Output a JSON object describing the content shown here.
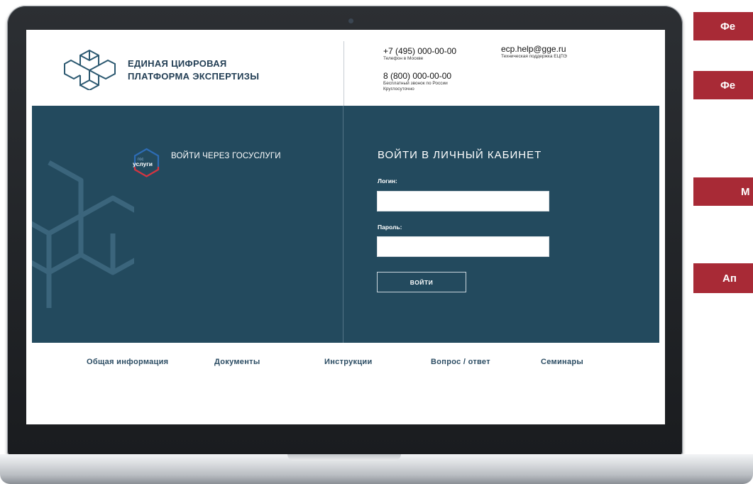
{
  "header": {
    "brand_line1": "ЕДИНАЯ ЦИФРОВАЯ",
    "brand_line2": "ПЛАТФОРМА ЭКСПЕРТИЗЫ",
    "phone_moscow": "+7 (495) 000-00-00",
    "phone_moscow_caption": "Телефон в Москве",
    "phone_free": "8 (800) 000-00-00",
    "phone_free_caption1": "Бесплатный звонок по России",
    "phone_free_caption2": "Круглосуточно",
    "email": "ecp.help@gge.ru",
    "email_caption": "Техническая поддержка ЕЦПЭ"
  },
  "gosuslugi": {
    "logo_text_top": "гос",
    "logo_text_main": "услуги",
    "label": "ВОЙТИ ЧЕРЕЗ ГОСУСЛУГИ"
  },
  "login": {
    "title": "ВОЙТИ В ЛИЧНЫЙ КАБИНЕТ",
    "login_label": "Логин:",
    "login_value": "",
    "password_label": "Пароль:",
    "password_value": "",
    "button_label": "ВОЙТИ"
  },
  "nav": {
    "items": [
      {
        "label": "Общая информация"
      },
      {
        "label": "Документы"
      },
      {
        "label": "Инструкции"
      },
      {
        "label": "Вопрос / ответ"
      },
      {
        "label": "Семинары"
      }
    ]
  },
  "side_tabs": [
    {
      "label": "Фе"
    },
    {
      "label": "Фе"
    },
    {
      "label": "М"
    },
    {
      "label": "Ап"
    }
  ],
  "colors": {
    "panel": "#234a5e",
    "accent_red": "#a82a36",
    "nav_text": "#2b4c63"
  }
}
